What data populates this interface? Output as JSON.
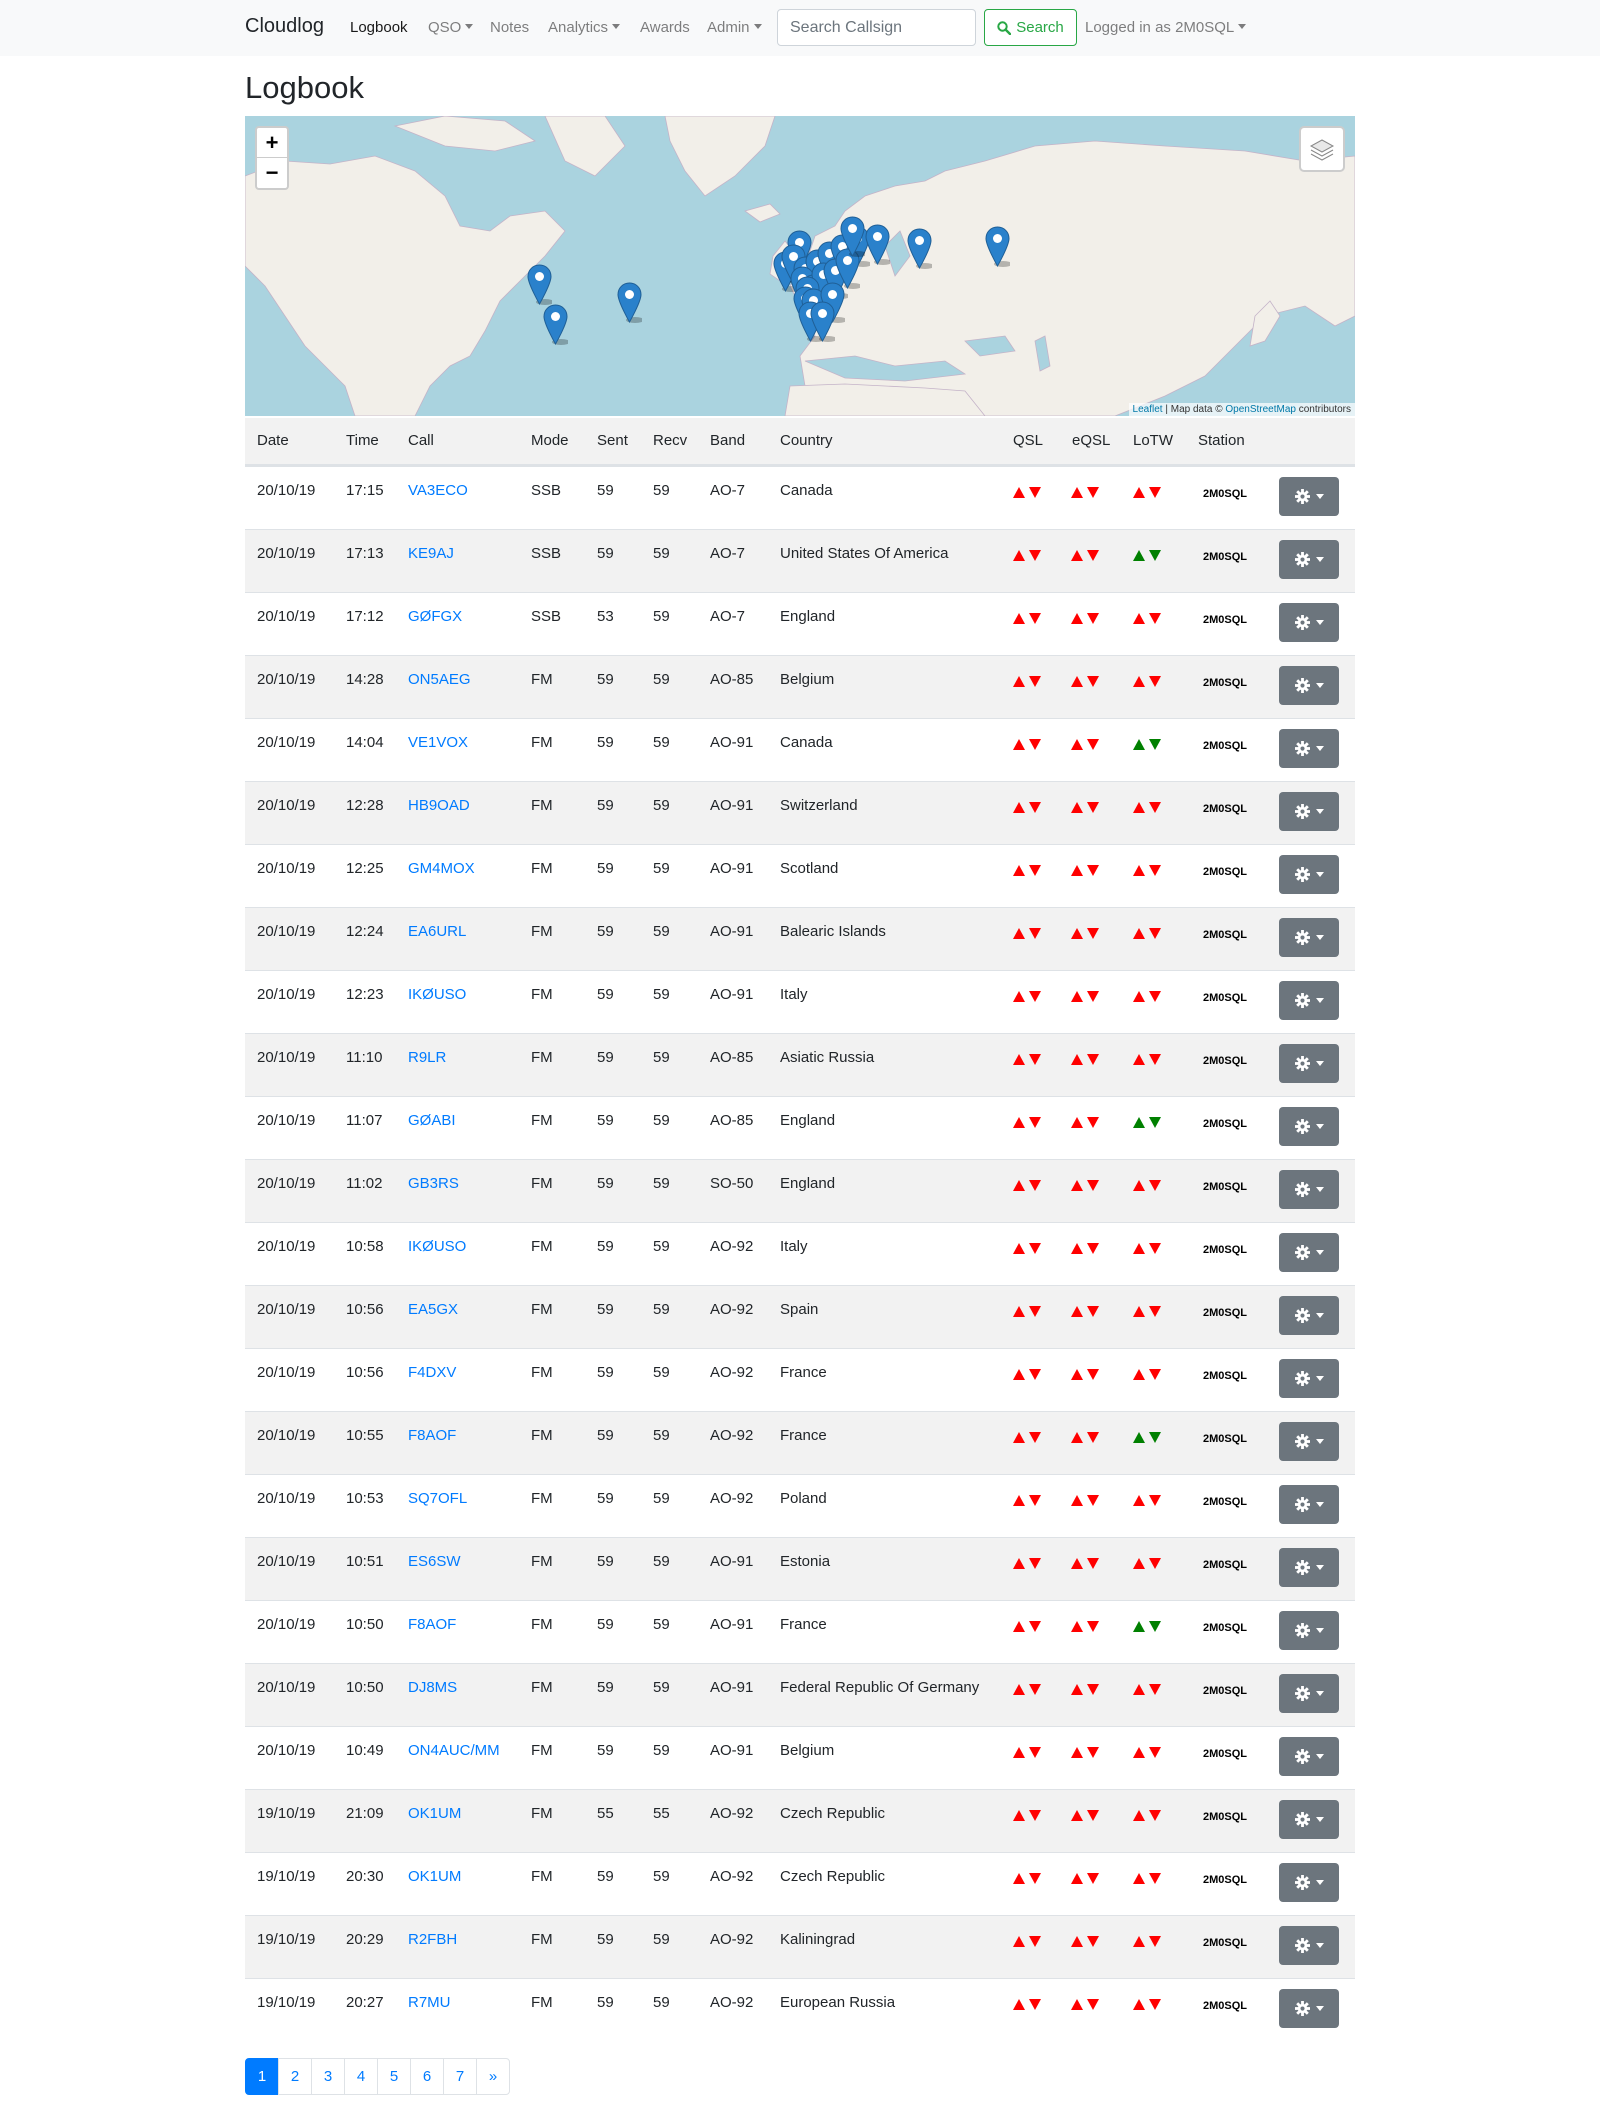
{
  "navbar": {
    "brand": "Cloudlog",
    "items": [
      {
        "label": "Logbook",
        "dropdown": false,
        "active": true
      },
      {
        "label": "QSO",
        "dropdown": true,
        "active": false
      },
      {
        "label": "Notes",
        "dropdown": false,
        "active": false
      },
      {
        "label": "Analytics",
        "dropdown": true,
        "active": false
      },
      {
        "label": "Awards",
        "dropdown": false,
        "active": false
      },
      {
        "label": "Admin",
        "dropdown": true,
        "active": false
      }
    ],
    "search_placeholder": "Search Callsign",
    "search_button": "Search",
    "user_label": "Logged in as 2M0SQL"
  },
  "page_title": "Logbook",
  "map": {
    "zoom_in": "+",
    "zoom_out": "−",
    "attribution_leaflet": "Leaflet",
    "attribution_text": " | Map data © ",
    "attribution_osm": "OpenStreetMap",
    "attribution_suffix": " contributors"
  },
  "table": {
    "headers": [
      "Date",
      "Time",
      "Call",
      "Mode",
      "Sent",
      "Recv",
      "Band",
      "Country",
      "QSL",
      "eQSL",
      "LoTW",
      "Station"
    ],
    "rows": [
      {
        "date": "20/10/19",
        "time": "17:15",
        "call": "VA3ECO",
        "mode": "SSB",
        "sent": "59",
        "recv": "59",
        "band": "AO-7",
        "country": "Canada",
        "lotw": "red",
        "station": "2M0SQL"
      },
      {
        "date": "20/10/19",
        "time": "17:13",
        "call": "KE9AJ",
        "mode": "SSB",
        "sent": "59",
        "recv": "59",
        "band": "AO-7",
        "country": "United States Of America",
        "lotw": "green",
        "station": "2M0SQL"
      },
      {
        "date": "20/10/19",
        "time": "17:12",
        "call": "GØFGX",
        "mode": "SSB",
        "sent": "53",
        "recv": "59",
        "band": "AO-7",
        "country": "England",
        "lotw": "red",
        "station": "2M0SQL"
      },
      {
        "date": "20/10/19",
        "time": "14:28",
        "call": "ON5AEG",
        "mode": "FM",
        "sent": "59",
        "recv": "59",
        "band": "AO-85",
        "country": "Belgium",
        "lotw": "red",
        "station": "2M0SQL"
      },
      {
        "date": "20/10/19",
        "time": "14:04",
        "call": "VE1VOX",
        "mode": "FM",
        "sent": "59",
        "recv": "59",
        "band": "AO-91",
        "country": "Canada",
        "lotw": "green",
        "station": "2M0SQL"
      },
      {
        "date": "20/10/19",
        "time": "12:28",
        "call": "HB9OAD",
        "mode": "FM",
        "sent": "59",
        "recv": "59",
        "band": "AO-91",
        "country": "Switzerland",
        "lotw": "red",
        "station": "2M0SQL"
      },
      {
        "date": "20/10/19",
        "time": "12:25",
        "call": "GM4MOX",
        "mode": "FM",
        "sent": "59",
        "recv": "59",
        "band": "AO-91",
        "country": "Scotland",
        "lotw": "red",
        "station": "2M0SQL"
      },
      {
        "date": "20/10/19",
        "time": "12:24",
        "call": "EA6URL",
        "mode": "FM",
        "sent": "59",
        "recv": "59",
        "band": "AO-91",
        "country": "Balearic Islands",
        "lotw": "red",
        "station": "2M0SQL"
      },
      {
        "date": "20/10/19",
        "time": "12:23",
        "call": "IKØUSO",
        "mode": "FM",
        "sent": "59",
        "recv": "59",
        "band": "AO-91",
        "country": "Italy",
        "lotw": "red",
        "station": "2M0SQL"
      },
      {
        "date": "20/10/19",
        "time": "11:10",
        "call": "R9LR",
        "mode": "FM",
        "sent": "59",
        "recv": "59",
        "band": "AO-85",
        "country": "Asiatic Russia",
        "lotw": "red",
        "station": "2M0SQL"
      },
      {
        "date": "20/10/19",
        "time": "11:07",
        "call": "GØABI",
        "mode": "FM",
        "sent": "59",
        "recv": "59",
        "band": "AO-85",
        "country": "England",
        "lotw": "green",
        "station": "2M0SQL"
      },
      {
        "date": "20/10/19",
        "time": "11:02",
        "call": "GB3RS",
        "mode": "FM",
        "sent": "59",
        "recv": "59",
        "band": "SO-50",
        "country": "England",
        "lotw": "red",
        "station": "2M0SQL"
      },
      {
        "date": "20/10/19",
        "time": "10:58",
        "call": "IKØUSO",
        "mode": "FM",
        "sent": "59",
        "recv": "59",
        "band": "AO-92",
        "country": "Italy",
        "lotw": "red",
        "station": "2M0SQL"
      },
      {
        "date": "20/10/19",
        "time": "10:56",
        "call": "EA5GX",
        "mode": "FM",
        "sent": "59",
        "recv": "59",
        "band": "AO-92",
        "country": "Spain",
        "lotw": "red",
        "station": "2M0SQL"
      },
      {
        "date": "20/10/19",
        "time": "10:56",
        "call": "F4DXV",
        "mode": "FM",
        "sent": "59",
        "recv": "59",
        "band": "AO-92",
        "country": "France",
        "lotw": "red",
        "station": "2M0SQL"
      },
      {
        "date": "20/10/19",
        "time": "10:55",
        "call": "F8AOF",
        "mode": "FM",
        "sent": "59",
        "recv": "59",
        "band": "AO-92",
        "country": "France",
        "lotw": "green",
        "station": "2M0SQL"
      },
      {
        "date": "20/10/19",
        "time": "10:53",
        "call": "SQ7OFL",
        "mode": "FM",
        "sent": "59",
        "recv": "59",
        "band": "AO-92",
        "country": "Poland",
        "lotw": "red",
        "station": "2M0SQL"
      },
      {
        "date": "20/10/19",
        "time": "10:51",
        "call": "ES6SW",
        "mode": "FM",
        "sent": "59",
        "recv": "59",
        "band": "AO-91",
        "country": "Estonia",
        "lotw": "red",
        "station": "2M0SQL"
      },
      {
        "date": "20/10/19",
        "time": "10:50",
        "call": "F8AOF",
        "mode": "FM",
        "sent": "59",
        "recv": "59",
        "band": "AO-91",
        "country": "France",
        "lotw": "green",
        "station": "2M0SQL"
      },
      {
        "date": "20/10/19",
        "time": "10:50",
        "call": "DJ8MS",
        "mode": "FM",
        "sent": "59",
        "recv": "59",
        "band": "AO-91",
        "country": "Federal Republic Of Germany",
        "lotw": "red",
        "station": "2M0SQL"
      },
      {
        "date": "20/10/19",
        "time": "10:49",
        "call": "ON4AUC/MM",
        "mode": "FM",
        "sent": "59",
        "recv": "59",
        "band": "AO-91",
        "country": "Belgium",
        "lotw": "red",
        "station": "2M0SQL"
      },
      {
        "date": "19/10/19",
        "time": "21:09",
        "call": "OK1UM",
        "mode": "FM",
        "sent": "55",
        "recv": "55",
        "band": "AO-92",
        "country": "Czech Republic",
        "lotw": "red",
        "station": "2M0SQL"
      },
      {
        "date": "19/10/19",
        "time": "20:30",
        "call": "OK1UM",
        "mode": "FM",
        "sent": "59",
        "recv": "59",
        "band": "AO-92",
        "country": "Czech Republic",
        "lotw": "red",
        "station": "2M0SQL"
      },
      {
        "date": "19/10/19",
        "time": "20:29",
        "call": "R2FBH",
        "mode": "FM",
        "sent": "59",
        "recv": "59",
        "band": "AO-92",
        "country": "Kaliningrad",
        "lotw": "red",
        "station": "2M0SQL"
      },
      {
        "date": "19/10/19",
        "time": "20:27",
        "call": "R7MU",
        "mode": "FM",
        "sent": "59",
        "recv": "59",
        "band": "AO-92",
        "country": "European Russia",
        "lotw": "red",
        "station": "2M0SQL"
      }
    ]
  },
  "pagination": {
    "pages": [
      "1",
      "2",
      "3",
      "4",
      "5",
      "6",
      "7",
      "»"
    ],
    "active": "1"
  },
  "colors": {
    "link": "#007bff",
    "success": "#28a745",
    "status_red": "#ff0000",
    "status_green": "#008000",
    "button_secondary": "#6c757d",
    "map_water": "#aad3df",
    "map_land": "#f2efe9",
    "marker": "#2a81cb"
  }
}
